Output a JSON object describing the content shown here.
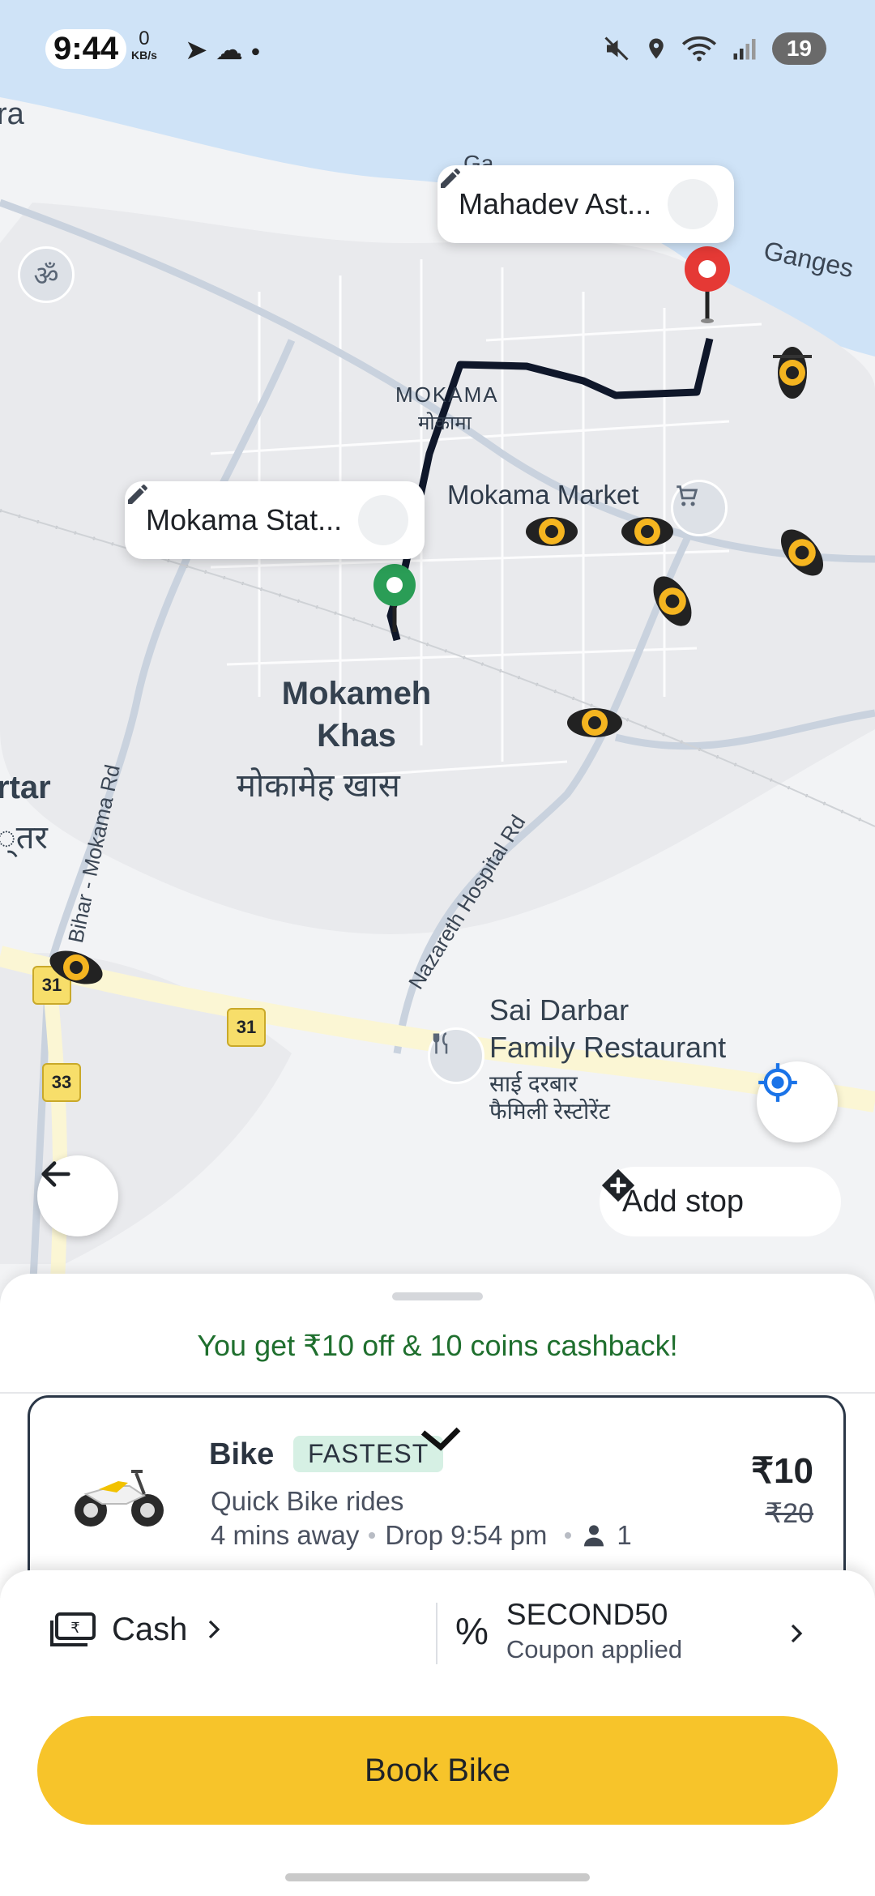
{
  "status_bar": {
    "time": "9:44",
    "net_speed": "0",
    "net_unit": "KB/s",
    "battery": "19"
  },
  "map": {
    "labels": {
      "ra": "ra",
      "ganga_partial": "Ga",
      "ganges": "Ganges",
      "mokama_en": "MOKAMA",
      "mokama_hi": "मोकामा",
      "mokama_market": "Mokama Market",
      "mokameh_khas_1": "Mokameh",
      "mokameh_khas_2": "Khas",
      "mokameh_khas_hi": "मोकामेह खास",
      "rtar": "rtar",
      "rtar_hi": "्तर",
      "bihar_mokama_rd": "Bihar - Mokama Rd",
      "nazareth_rd": "Nazareth Hospital Rd",
      "restaurant_1": "Sai Darbar",
      "restaurant_2": "Family Restaurant",
      "restaurant_hi_1": "साई दरबार",
      "restaurant_hi_2": "फैमिली रेस्टोरेंट",
      "nh31_a": "31",
      "nh31_b": "31",
      "nh33": "33"
    },
    "drop_location": "Mahadev Ast...",
    "pickup_location": "Mokama Stat...",
    "add_stop": "Add stop"
  },
  "sheet": {
    "promo": "You get ₹10 off & 10 coins cashback!",
    "ride": {
      "title": "Bike",
      "badge": "FASTEST",
      "subtitle": "Quick Bike rides",
      "eta": "4 mins away",
      "drop": "Drop 9:54 pm",
      "seats": "1",
      "price": "₹10",
      "old_price": "₹20"
    },
    "payment": {
      "method": "Cash",
      "coupon_code": "SECOND50",
      "coupon_status": "Coupon applied"
    },
    "book_label": "Book Bike"
  },
  "colors": {
    "accent": "#f7c42a",
    "promo_green": "#1f6f2e",
    "route": "#111827",
    "river": "#cfe3f7"
  }
}
